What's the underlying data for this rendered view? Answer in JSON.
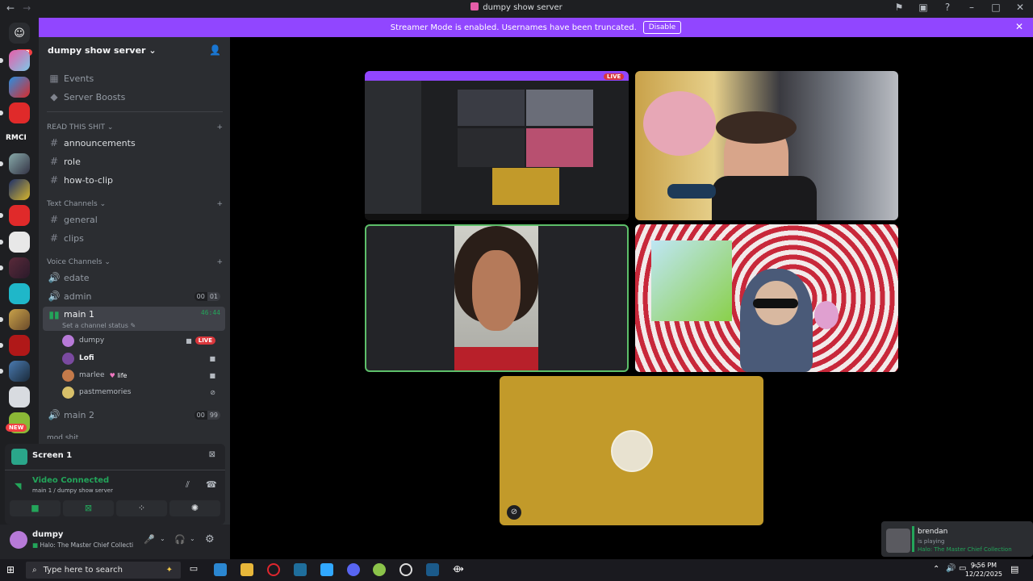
{
  "window": {
    "title": "dumpy show server"
  },
  "banner": {
    "text": "Streamer Mode is enabled. Usernames have been truncated.",
    "button": "Disable"
  },
  "guilds": {
    "dm_badge": "692",
    "rmci": "RMCI",
    "new_badge": "NEW"
  },
  "server": {
    "name": "dumpy show server"
  },
  "top_items": [
    {
      "label": "Events"
    },
    {
      "label": "Server Boosts"
    }
  ],
  "categories": {
    "read": "READ THIS SHIT",
    "text": "Text Channels",
    "voice": "Voice Channels",
    "mod": "mod shit"
  },
  "read_channels": [
    "announcements",
    "role",
    "how-to-clip"
  ],
  "text_channels": [
    "general",
    "clips"
  ],
  "voice": {
    "edate": "edate",
    "admin": {
      "name": "admin",
      "count_a": "00",
      "count_b": "01"
    },
    "main1": {
      "name": "main 1",
      "timer": "46:44",
      "status": "Set a channel status"
    },
    "users": [
      {
        "name": "dumpy",
        "live": "LIVE"
      },
      {
        "name": "Lofi"
      },
      {
        "name": "marlee",
        "tag": "life"
      },
      {
        "name": "pastmemories"
      }
    ],
    "main2": {
      "name": "main 2",
      "count_a": "00",
      "count_b": "99"
    }
  },
  "screen_panel": {
    "title": "Screen 1",
    "status": "Video Connected",
    "location": "main 1 / dumpy show server"
  },
  "user": {
    "name": "dumpy",
    "activity": "Halo: The Master Chief Collecti..."
  },
  "taskbar": {
    "search_placeholder": "Type here to search",
    "time": "9:56 PM",
    "date": "12/22/2025"
  },
  "notification": {
    "user": "brendan",
    "verb": "is playing",
    "game": "Halo: The Master Chief Collection"
  },
  "colors": {
    "accent": "#9146ff",
    "green": "#23a55a",
    "live": "#da373c",
    "yellow_tile": "#c29a2a"
  }
}
